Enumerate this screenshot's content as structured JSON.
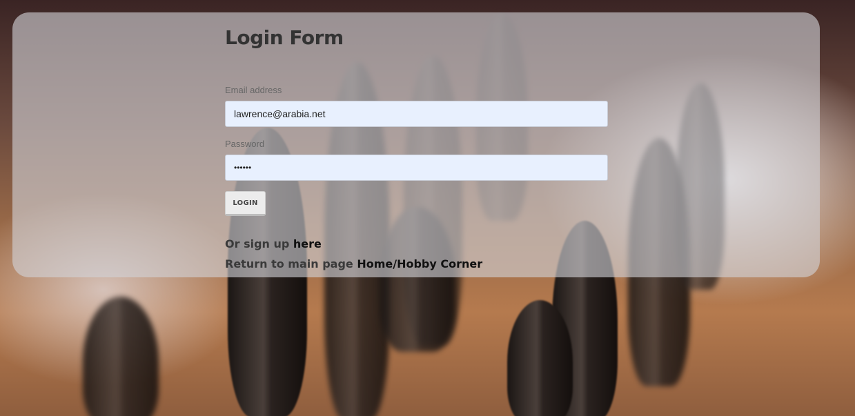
{
  "form": {
    "title": "Login Form",
    "email_label": "Email address",
    "email_value": "lawrence@arabia.net",
    "password_label": "Password",
    "password_value": "••••••",
    "login_button": "LOGIN"
  },
  "links": {
    "signup_prefix": "Or sign up ",
    "signup_link": "here",
    "return_prefix": "Return to main page ",
    "return_link": "Home/Hobby Corner"
  }
}
